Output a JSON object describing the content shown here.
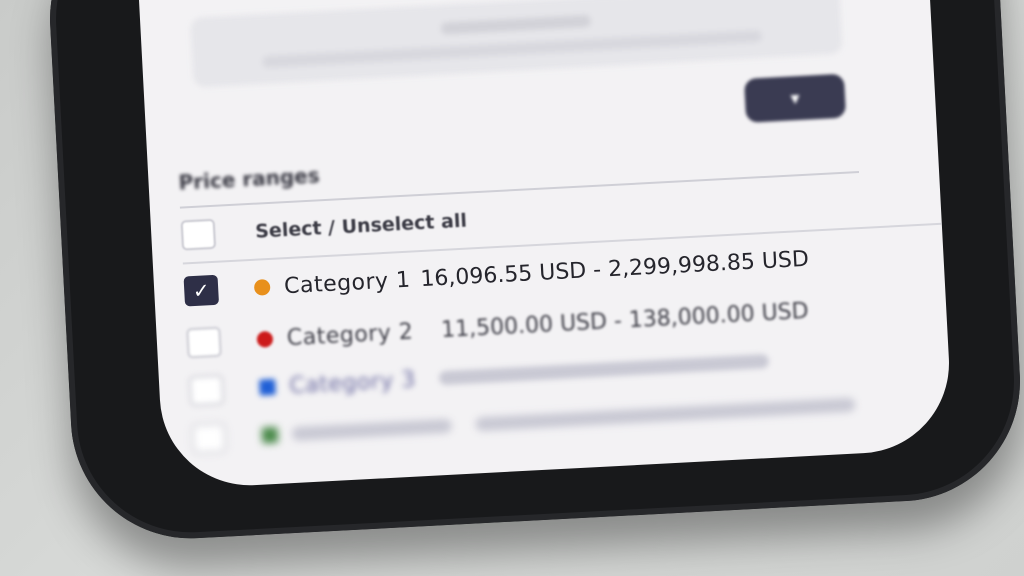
{
  "filter": {
    "section_title": "Price ranges",
    "select_all_label": "Select / Unselect all",
    "toggle_icon": "chevron-down-icon",
    "categories": [
      {
        "label": "Category 1",
        "range": "16,096.55 USD - 2,299,998.85 USD",
        "color": "#e8901c",
        "checked": true
      },
      {
        "label": "Category 2",
        "range": "11,500.00 USD - 138,000.00 USD",
        "color": "#cc1a1a",
        "checked": false
      },
      {
        "label": "Category 3",
        "range": "",
        "color": "#1f5fd6",
        "checked": false
      },
      {
        "label": "",
        "range": "",
        "color": "#4a8a4a",
        "checked": false
      }
    ]
  },
  "colors": {
    "checkbox_checked": "#2e2f47",
    "screen_bg": "#f3f2f4",
    "phone_frame": "#18191b"
  }
}
